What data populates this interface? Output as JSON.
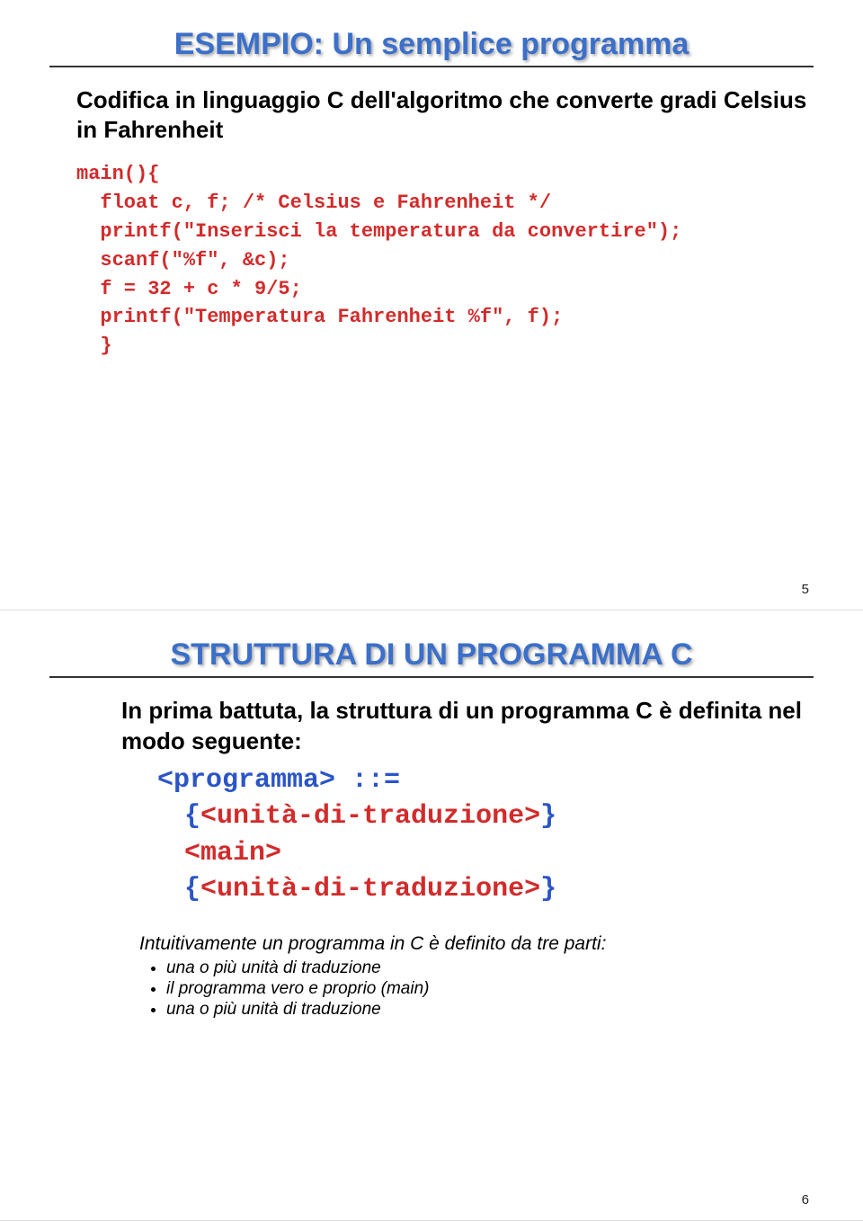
{
  "slide1": {
    "title": "ESEMPIO: Un semplice programma",
    "intro": "Codifica in linguaggio C dell'algoritmo che converte gradi Celsius in Fahrenheit",
    "code": "main(){\n  float c, f; /* Celsius e Fahrenheit */\n  printf(\"Inserisci la temperatura da convertire\");\n  scanf(\"%f\", &c);\n  f = 32 + c * 9/5;\n  printf(\"Temperatura Fahrenheit %f\", f);\n  }",
    "page_num": "5"
  },
  "slide2": {
    "title": "STRUTTURA DI UN PROGRAMMA C",
    "intro": "In prima battuta, la struttura di un programma C è definita nel modo seguente:",
    "grammar_prog": "<programma> ::=",
    "grammar_u1_open": "{",
    "grammar_u1": "<unità-di-traduzione>",
    "grammar_u1_close": "}",
    "grammar_main": "<main>",
    "grammar_u2_open": "{",
    "grammar_u2": "<unità-di-traduzione>",
    "grammar_u2_close": "}",
    "note": "Intuitivamente un programma in C è definito da tre parti:",
    "b1": "una o più unità di traduzione",
    "b2": "il programma vero e proprio (main)",
    "b3": "una o più unità di traduzione",
    "page_num": "6"
  }
}
